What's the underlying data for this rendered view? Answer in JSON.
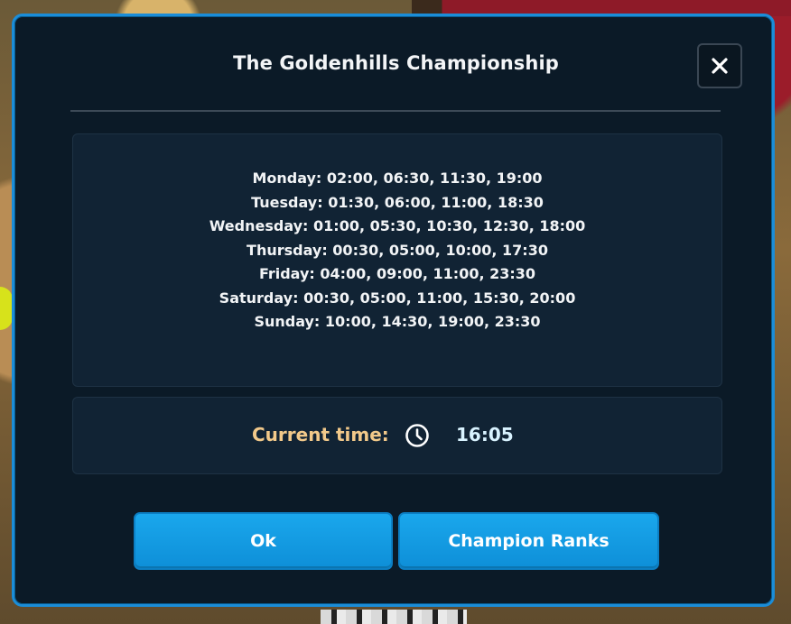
{
  "dialog": {
    "title": "The Goldenhills Championship",
    "close_icon": "close-icon"
  },
  "schedule": [
    "Monday: 02:00, 06:30, 11:30, 19:00",
    "Tuesday: 01:30, 06:00, 11:00, 18:30",
    "Wednesday: 01:00, 05:30, 10:30, 12:30, 18:00",
    "Thursday: 00:30, 05:00, 10:00, 17:30",
    "Friday: 04:00, 09:00, 11:00, 23:30",
    "Saturday: 00:30, 05:00, 11:00, 15:30, 20:00",
    "Sunday: 10:00, 14:30, 19:00, 23:30"
  ],
  "current_time": {
    "label": "Current time:",
    "icon": "clock-icon",
    "value": "16:05"
  },
  "buttons": {
    "ok_label": "Ok",
    "champion_ranks_label": "Champion Ranks"
  },
  "colors": {
    "modal_bg": "#0b1a27",
    "panel_bg": "#112334",
    "accent": "#1aa7ec",
    "border": "#1b8dd8",
    "time_label": "#f2c98a",
    "time_value": "#d9f3ff"
  }
}
